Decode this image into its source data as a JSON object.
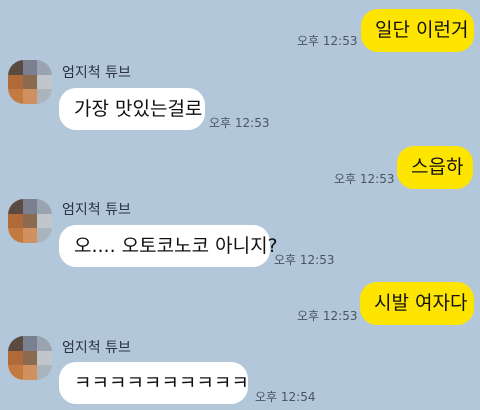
{
  "messages": [
    {
      "side": "mine",
      "text": "일단 이런거",
      "time": "오후 12:53"
    },
    {
      "side": "theirs",
      "sender": "엄지척 튜브",
      "text": "가장 맛있는걸로",
      "time": "오후 12:53"
    },
    {
      "side": "mine",
      "text": "스읍하",
      "time": "오후 12:53"
    },
    {
      "side": "theirs",
      "sender": "엄지척 튜브",
      "text": "오.... 오토코노코 아니지?",
      "time": "오후 12:53"
    },
    {
      "side": "mine",
      "text": "시발 여자다",
      "time": "오후 12:53"
    },
    {
      "side": "theirs",
      "sender": "엄지척 튜브",
      "text": "ㅋㅋㅋㅋㅋㅋㅋㅋㅋㅋ",
      "time": "오후 12:54"
    }
  ],
  "avatar_pixel_colors": [
    "#5a4a40",
    "#7a8090",
    "#9aa4b0",
    "#b06a3a",
    "#8a6a50",
    "#c0c6cc",
    "#c27a40",
    "#d09060",
    "#aab4bc"
  ]
}
